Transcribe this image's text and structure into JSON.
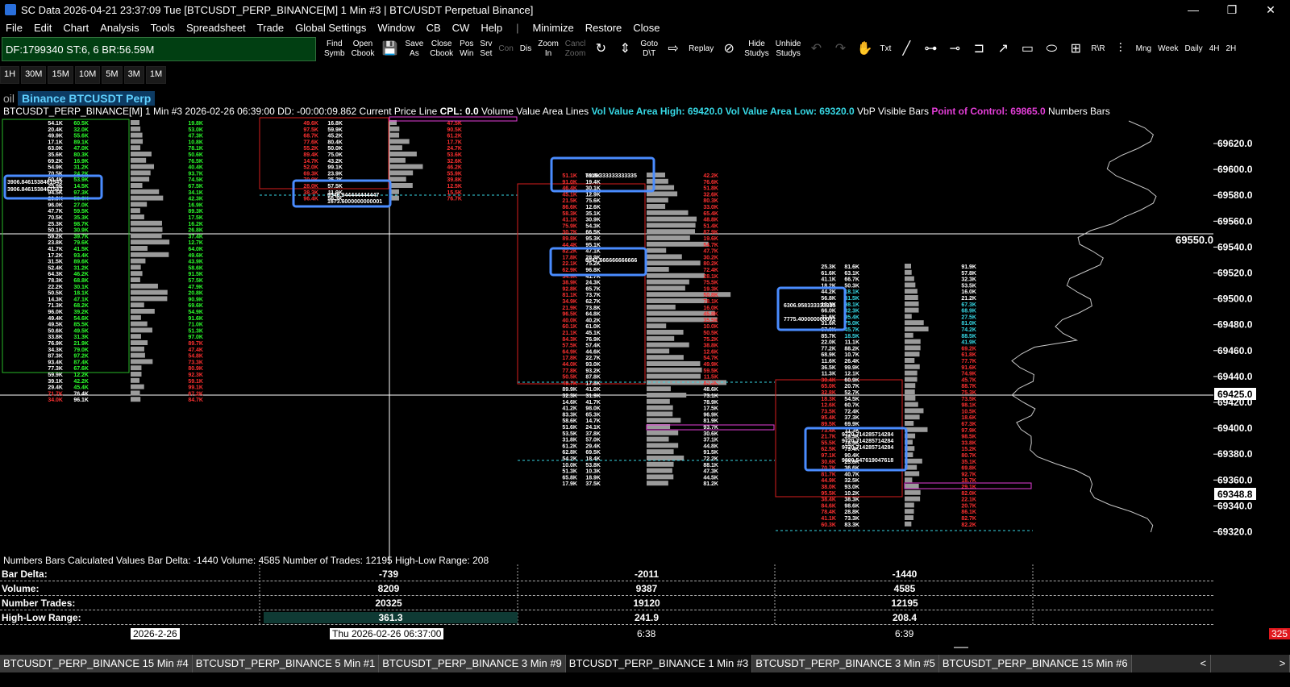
{
  "window": {
    "title": "SC Data 2026-04-21  23:37:09 Tue [BTCUSDT_PERP_BINANCE[M]  1 Min  #3 | BTC/USDT Perpetual Binance]",
    "controls": [
      "—",
      "❐",
      "✕"
    ]
  },
  "menu": {
    "items": [
      "File",
      "Edit",
      "Chart",
      "Analysis",
      "Tools",
      "Spreadsheet",
      "Trade",
      "Global Settings",
      "Window",
      "CB",
      "CW",
      "Help"
    ],
    "sep": "|",
    "window_items": [
      "Minimize",
      "Restore",
      "Close"
    ]
  },
  "toolbar": {
    "df": "DF:1799340  ST:6, 6  BR:56.59M",
    "buttons": [
      {
        "label": "Find Symb",
        "enabled": true
      },
      {
        "label": "Open Cbook",
        "enabled": true
      },
      {
        "label": "💾",
        "enabled": true,
        "icon": "save-icon"
      },
      {
        "label": "Save As",
        "enabled": true
      },
      {
        "label": "Close Cbook",
        "enabled": true
      },
      {
        "label": "Pos Win",
        "enabled": true
      },
      {
        "label": "Srv Set",
        "enabled": true
      },
      {
        "label": "Con",
        "enabled": false
      },
      {
        "label": "Dis",
        "enabled": true
      },
      {
        "label": "Zoom In",
        "enabled": true
      },
      {
        "label": "Cancl Zoom",
        "enabled": false
      },
      {
        "label": "↻",
        "enabled": true,
        "icon": "refresh-icon"
      },
      {
        "label": "⇕",
        "enabled": true,
        "icon": "vertical-scale-icon"
      },
      {
        "label": "Goto D\\T",
        "enabled": true
      },
      {
        "label": "⇨",
        "enabled": true,
        "icon": "goto-arrow-icon"
      },
      {
        "label": "Replay",
        "enabled": true
      },
      {
        "label": "⊘",
        "enabled": true,
        "icon": "hide-icon"
      },
      {
        "label": "Hide Studys",
        "enabled": true
      },
      {
        "label": "Unhide Studys",
        "enabled": true
      },
      {
        "label": "↶",
        "enabled": false,
        "icon": "undo-icon"
      },
      {
        "label": "↷",
        "enabled": false,
        "icon": "redo-icon"
      },
      {
        "label": "✋",
        "enabled": true,
        "icon": "hand-pointer-icon"
      },
      {
        "label": "Txt",
        "enabled": true
      },
      {
        "label": "╱",
        "enabled": true,
        "icon": "line-tool-icon"
      },
      {
        "label": "⊶",
        "enabled": true,
        "icon": "ray-tool-icon"
      },
      {
        "label": "⊸",
        "enabled": true,
        "icon": "horizontal-line-icon"
      },
      {
        "label": "⊐",
        "enabled": true,
        "icon": "marker-icon"
      },
      {
        "label": "↗",
        "enabled": true,
        "icon": "arrow-tool-icon"
      },
      {
        "label": "▭",
        "enabled": true,
        "icon": "rectangle-tool-icon"
      },
      {
        "label": "⬭",
        "enabled": true,
        "icon": "ellipse-tool-icon"
      },
      {
        "label": "⊞",
        "enabled": true,
        "icon": "calc-tool-icon"
      },
      {
        "label": "R\\R",
        "enabled": true
      },
      {
        "label": "⫶",
        "enabled": true,
        "icon": "fib-tool-icon"
      },
      {
        "label": "Mng",
        "enabled": true
      },
      {
        "label": "Week",
        "enabled": true
      },
      {
        "label": "Daily",
        "enabled": true
      },
      {
        "label": "4H",
        "enabled": true
      },
      {
        "label": "2H",
        "enabled": true
      }
    ]
  },
  "timeframes": [
    "1H",
    "30M",
    "15M",
    "10M",
    "5M",
    "3M",
    "1M"
  ],
  "symbol_tab": {
    "prefix": "oil",
    "label": "Binance BTCUSDT Perp"
  },
  "chart_header": {
    "main": "BTCUSDT_PERP_BINANCE[M]  1 Min  #3 2026-02-26 06:39:00 DD: -00:00:09.862 Current Price Line",
    "cpl": "CPL: 0.0",
    "vval": "Volume Value Area Lines",
    "vah": "Vol Value Area High: 69420.0",
    "val": "Vol Value Area Low: 69320.0",
    "vbp": "VbP Visible Bars",
    "poc": "Point of Control: 69865.0",
    "nb": "Numbers Bars"
  },
  "price_axis": {
    "labels": [
      "69620.0",
      "69600.0",
      "69580.0",
      "69560.0",
      "69540.0",
      "69520.0",
      "69500.0",
      "69480.0",
      "69460.0",
      "69440.0",
      "69420.0",
      "69400.0",
      "69380.0",
      "69360.0",
      "69340.0",
      "69320.0"
    ],
    "current_a": "69550.0",
    "current_b": "69425.0",
    "current_c": "69348.8"
  },
  "annotations": {
    "bar1_a": "3906.8461538461543",
    "bar1_b": "3906.8461538461543",
    "bar2_a": "9546.944444444447",
    "bar2_b": "1673.6000000000001",
    "bar3_a": "7115.333333333335",
    "bar3_b": "6047.666666666666",
    "bar4_a": "6306.958333333333",
    "bar4_b": "7775.400000000001",
    "bar4_c": "9770.714285714284",
    "bar4_d": "9770.714285714284",
    "bar4_e": "9770.714285714284",
    "bar4_f": "9890.547619047618"
  },
  "numbers_calc": "Numbers Bars Calculated Values  Bar Delta: -1440  Volume: 4585  Number of Trades: 12195  High-Low Range: 208",
  "stats": {
    "labels": [
      "Bar Delta:",
      "Volume:",
      "Number Trades:",
      "High-Low Range:"
    ],
    "col1": [
      "-739",
      "8209",
      "20325",
      "361.3"
    ],
    "col2": [
      "-2011",
      "9387",
      "19120",
      "241.9"
    ],
    "col3": [
      "-1440",
      "4585",
      "12195",
      "208.4"
    ]
  },
  "date_axis": {
    "d1": "2026-2-26",
    "d2": "Thu 2026-02-26  06:37:00",
    "d3": "6:38",
    "d4": "6:39",
    "right": "325"
  },
  "tabs": [
    {
      "label": "BTCUSDT_PERP_BINANCE  15 Min  #4",
      "active": false
    },
    {
      "label": "BTCUSDT_PERP_BINANCE  5 Min  #1",
      "active": false
    },
    {
      "label": "BTCUSDT_PERP_BINANCE  3 Min  #9",
      "active": false
    },
    {
      "label": "BTCUSDT_PERP_BINANCE  1 Min  #3",
      "active": true
    },
    {
      "label": "BTCUSDT_PERP_BINANCE  3 Min  #5",
      "active": false
    },
    {
      "label": "BTCUSDT_PERP_BINANCE  15 Min  #6",
      "active": false
    }
  ],
  "colors": {
    "bid": "#ff2b2b",
    "ask": "#2cff2c",
    "cyan": "#37d9e6",
    "magenta": "#e43ed8",
    "highlight": "#4a8cff"
  }
}
